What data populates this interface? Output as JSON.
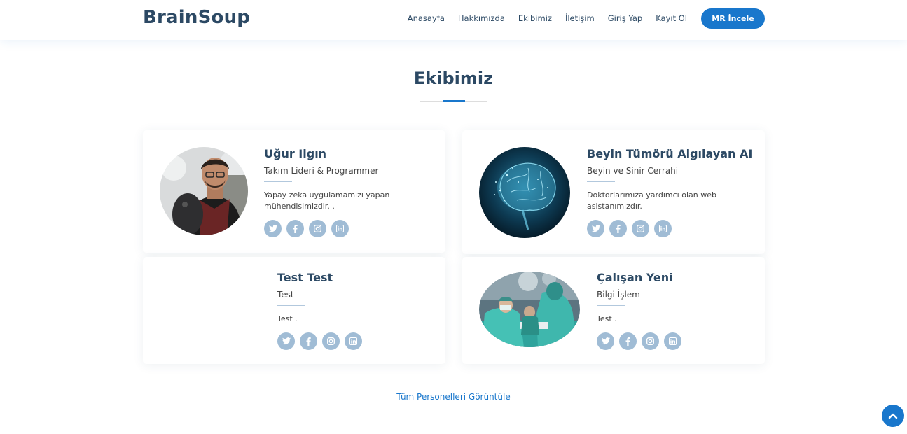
{
  "header": {
    "logo": "BrainSoup",
    "nav": [
      "Anasayfa",
      "Hakkımızda",
      "Ekibimiz",
      "İletişim",
      "Giriş Yap",
      "Kayıt Ol"
    ],
    "cta_label": "MR İncele"
  },
  "section": {
    "title": "Ekibimiz",
    "view_all": "Tüm Personelleri Görüntüle"
  },
  "team": [
    {
      "name": "Uğur Ilgın",
      "role": "Takım Lideri & Programmer",
      "desc": "Yapay zeka uygulamamızı yapan mühendisimizdir. ."
    },
    {
      "name": "Beyin Tümörü Algılayan AI",
      "role": "Beyin ve Sinir Cerrahi",
      "desc": "Doktorlarımıza yardımcı olan web asistanımızdır."
    },
    {
      "name": "Test Test",
      "role": "Test",
      "desc": "Test ."
    },
    {
      "name": "Çalışan Yeni",
      "role": "Bilgi İşlem",
      "desc": "Test ."
    }
  ],
  "social_icons": [
    "twitter-icon",
    "facebook-icon",
    "instagram-icon",
    "linkedin-icon"
  ],
  "colors": {
    "accent": "#1977cc",
    "heading": "#2c4964",
    "social": "#a0bcd5"
  }
}
